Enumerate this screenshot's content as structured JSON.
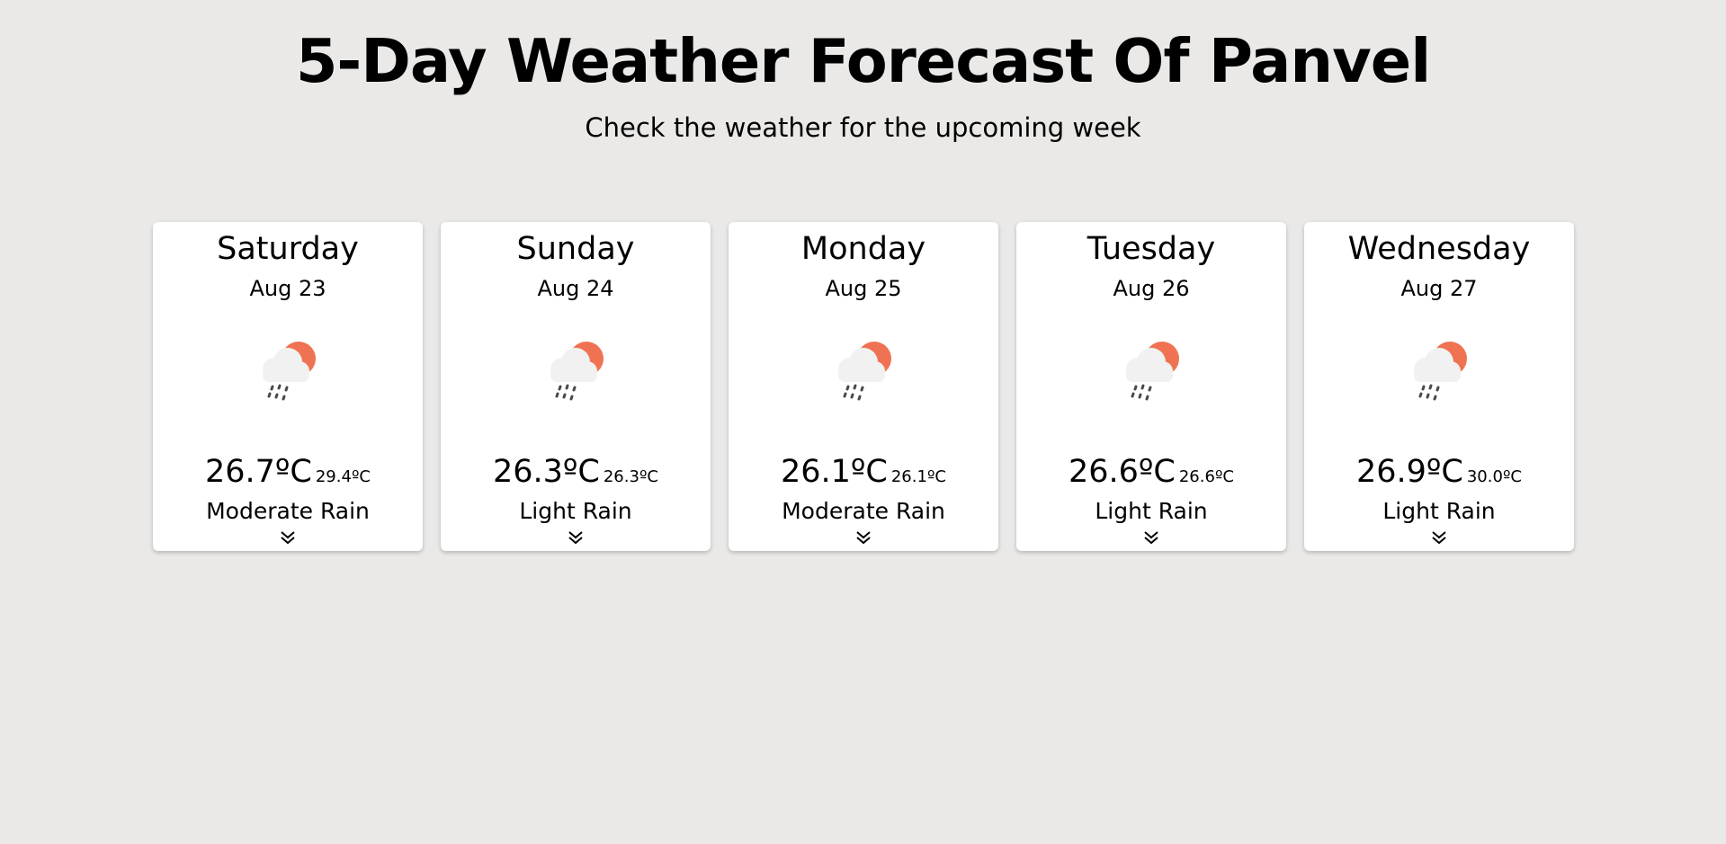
{
  "header": {
    "title": "5-Day Weather Forecast Of Panvel",
    "subtitle": "Check the weather for the upcoming week"
  },
  "colors": {
    "background": "#eae9e7",
    "sun": "#ef7352",
    "cloud": "#f1f1f1",
    "rain": "#4a4a4a"
  },
  "forecast": [
    {
      "day": "Saturday",
      "date": "Aug 23",
      "temp": "26.7ºC",
      "temp_secondary": "29.4ºC",
      "condition": "Moderate Rain",
      "icon": "cloud-sun-rain-icon"
    },
    {
      "day": "Sunday",
      "date": "Aug 24",
      "temp": "26.3ºC",
      "temp_secondary": "26.3ºC",
      "condition": "Light Rain",
      "icon": "cloud-sun-rain-icon"
    },
    {
      "day": "Monday",
      "date": "Aug 25",
      "temp": "26.1ºC",
      "temp_secondary": "26.1ºC",
      "condition": "Moderate Rain",
      "icon": "cloud-sun-rain-icon"
    },
    {
      "day": "Tuesday",
      "date": "Aug 26",
      "temp": "26.6ºC",
      "temp_secondary": "26.6ºC",
      "condition": "Light Rain",
      "icon": "cloud-sun-rain-icon"
    },
    {
      "day": "Wednesday",
      "date": "Aug 27",
      "temp": "26.9ºC",
      "temp_secondary": "30.0ºC",
      "condition": "Light Rain",
      "icon": "cloud-sun-rain-icon"
    }
  ]
}
